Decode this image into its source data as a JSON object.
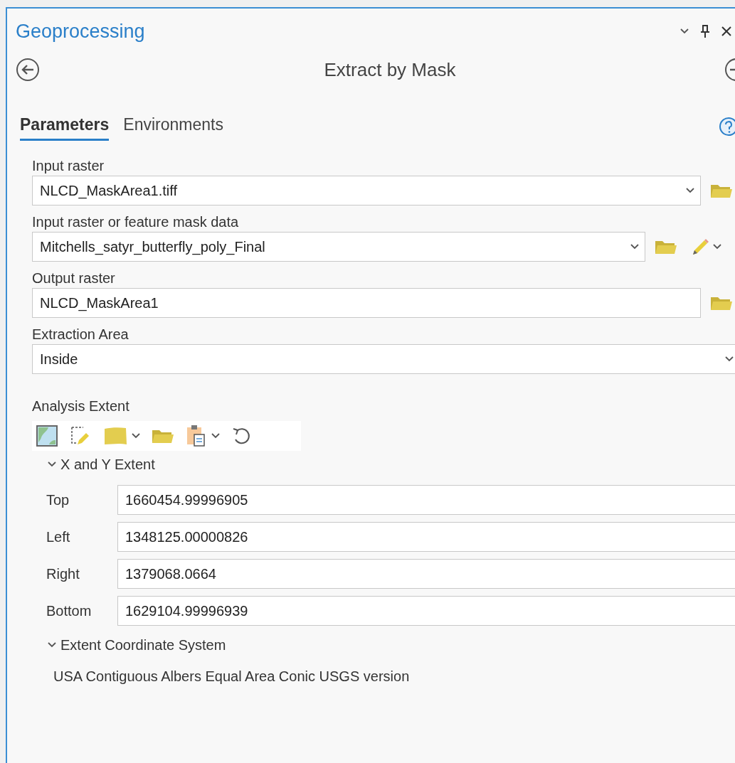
{
  "panel": {
    "title": "Geoprocessing"
  },
  "tool": {
    "title": "Extract by Mask"
  },
  "tabs": [
    {
      "label": "Parameters",
      "selected": true
    },
    {
      "label": "Environments",
      "selected": false
    }
  ],
  "parameters": [
    {
      "kind": "dropdown-browse",
      "label": "Input raster",
      "value": "NLCD_MaskArea1.tiff"
    },
    {
      "kind": "dropdown-browse-draw",
      "label": "Input raster or feature mask data",
      "value": "Mitchells_satyr_butterfly_poly_Final"
    },
    {
      "kind": "text-browse",
      "label": "Output raster",
      "value": "NLCD_MaskArea1"
    },
    {
      "kind": "dropdown",
      "label": "Extraction Area",
      "value": "Inside"
    }
  ],
  "analysis_extent": {
    "label": "Analysis Extent",
    "xy_extent": {
      "label": "X and Y Extent",
      "expanded": true,
      "fields": [
        {
          "label": "Top",
          "value": "1660454.99996905"
        },
        {
          "label": "Left",
          "value": "1348125.00000826"
        },
        {
          "label": "Right",
          "value": "1379068.0664"
        },
        {
          "label": "Bottom",
          "value": "1629104.99996939"
        }
      ]
    },
    "coordinate_system": {
      "label": "Extent Coordinate System",
      "expanded": true,
      "value": "USA Contiguous Albers Equal Area Conic USGS version"
    }
  }
}
